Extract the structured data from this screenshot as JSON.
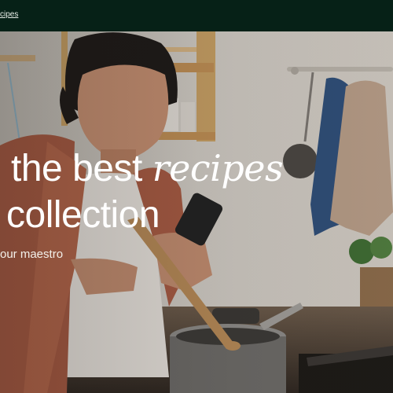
{
  "nav": {
    "recipes_link": "cipes"
  },
  "hero": {
    "headline_plain": "the best",
    "headline_script": "recipes",
    "headline_line2": "collection",
    "subtitle": "our maestro"
  }
}
